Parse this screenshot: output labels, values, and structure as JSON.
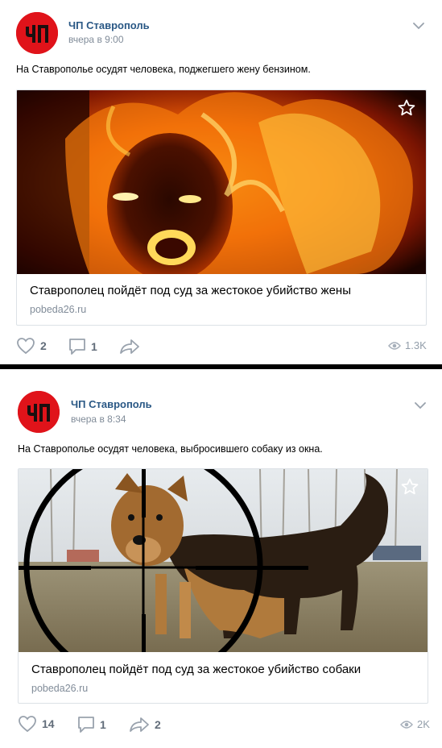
{
  "posts": [
    {
      "author": "ЧП Ставрополь",
      "date": "вчера в 9:00",
      "text": "На Ставрополье осудят человека, поджегшего жену бензином.",
      "link_title": "Ставрополец пойдёт под суд за жестокое убийство жены",
      "link_domain": "pobeda26.ru",
      "likes": "2",
      "comments": "1",
      "shares": "",
      "views": "1.3K"
    },
    {
      "author": "ЧП Ставрополь",
      "date": "вчера в 8:34",
      "text": "На Ставрополье осудят человека, выбросившего собаку из окна.",
      "link_title": "Ставрополец пойдёт под суд за жестокое убийство собаки",
      "link_domain": "pobeda26.ru",
      "likes": "14",
      "comments": "1",
      "shares": "2",
      "views": "2K"
    }
  ],
  "avatar_text": "ЧП",
  "colors": {
    "brand_red": "#e0131a",
    "link_blue": "#2a5885",
    "muted": "#818c99",
    "icon": "#99a2ad"
  },
  "icons": {
    "like": "heart-icon",
    "comment": "comment-icon",
    "share": "share-arrow-icon",
    "views": "eye-icon",
    "bookmark": "star-icon",
    "menu": "chevron-down-icon"
  }
}
